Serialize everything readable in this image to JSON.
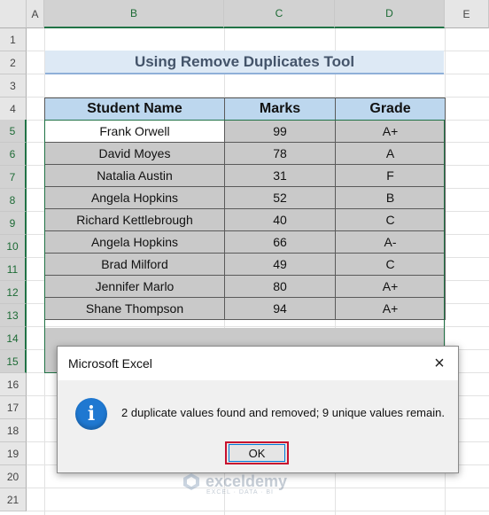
{
  "spreadsheet": {
    "columns": [
      "A",
      "B",
      "C",
      "D",
      "E"
    ],
    "rows": [
      "1",
      "2",
      "3",
      "4",
      "5",
      "6",
      "7",
      "8",
      "9",
      "10",
      "11",
      "12",
      "13",
      "14",
      "15",
      "16",
      "17",
      "18",
      "19",
      "20",
      "21"
    ],
    "title": "Using Remove Duplicates Tool",
    "headers": {
      "name": "Student Name",
      "marks": "Marks",
      "grade": "Grade"
    },
    "records": [
      {
        "name": "Frank Orwell",
        "marks": "99",
        "grade": "A+"
      },
      {
        "name": "David Moyes",
        "marks": "78",
        "grade": "A"
      },
      {
        "name": "Natalia Austin",
        "marks": "31",
        "grade": "F"
      },
      {
        "name": "Angela Hopkins",
        "marks": "52",
        "grade": "B"
      },
      {
        "name": "Richard Kettlebrough",
        "marks": "40",
        "grade": "C"
      },
      {
        "name": "Angela Hopkins",
        "marks": "66",
        "grade": "A-"
      },
      {
        "name": "Brad Milford",
        "marks": "49",
        "grade": "C"
      },
      {
        "name": "Jennifer Marlo",
        "marks": "80",
        "grade": "A+"
      },
      {
        "name": "Shane Thompson",
        "marks": "94",
        "grade": "A+"
      }
    ]
  },
  "dialog": {
    "title": "Microsoft Excel",
    "close_icon": "×",
    "info_icon": "i",
    "message": "2 duplicate values found and removed; 9 unique values remain.",
    "ok_label": "OK"
  },
  "watermark": {
    "name": "exceldemy",
    "tagline": "EXCEL · DATA · BI"
  },
  "colors": {
    "accent": "#217346",
    "header_fill": "#bdd7ee",
    "title_fill": "#dde9f5",
    "info_blue": "#1f78d1",
    "ok_border": "#c8102e"
  }
}
